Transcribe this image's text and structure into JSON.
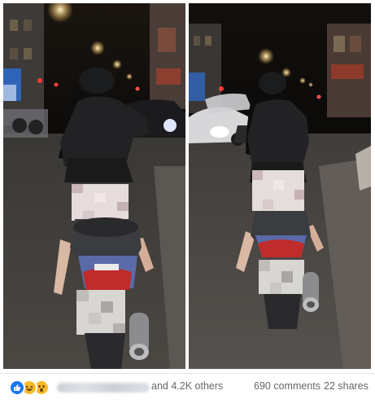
{
  "post": {
    "photos": [
      {
        "description_icon": "photo-icon"
      },
      {
        "description_icon": "photo-icon"
      }
    ],
    "reactions": {
      "types": [
        "like-icon",
        "haha-icon",
        "wow-icon"
      ],
      "count_text": "and 4.2K others"
    },
    "comments_text": "690 comments",
    "shares_text": "22 shares"
  },
  "colors": {
    "like": "#1877f2",
    "emoji": "#f7b928",
    "meta_text": "#65676b"
  }
}
